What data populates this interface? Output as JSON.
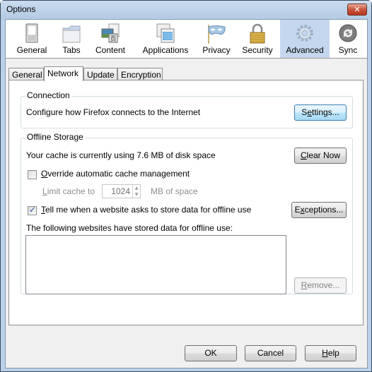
{
  "window": {
    "title": "Options",
    "close_label": "✕"
  },
  "toolbar": {
    "panes": [
      {
        "label": "General",
        "icon": "switch-icon",
        "selected": false
      },
      {
        "label": "Tabs",
        "icon": "folder-tab-icon",
        "selected": false
      },
      {
        "label": "Content",
        "icon": "content-icon",
        "selected": false
      },
      {
        "label": "Applications",
        "icon": "applications-icon",
        "selected": false
      },
      {
        "label": "Privacy",
        "icon": "mask-icon",
        "selected": false
      },
      {
        "label": "Security",
        "icon": "padlock-icon",
        "selected": false
      },
      {
        "label": "Advanced",
        "icon": "gear-icon",
        "selected": true
      },
      {
        "label": "Sync",
        "icon": "sync-icon",
        "selected": false
      }
    ]
  },
  "tabs": [
    {
      "label": "General",
      "active": false
    },
    {
      "label": "Network",
      "active": true
    },
    {
      "label": "Update",
      "active": false
    },
    {
      "label": "Encryption",
      "active": false
    }
  ],
  "connection": {
    "group_label": "Connection",
    "description": "Configure how Firefox connects to the Internet",
    "settings_button": {
      "pre": "S",
      "accel": "e",
      "post": "ttings..."
    }
  },
  "offline_storage": {
    "group_label": "Offline Storage",
    "cache_usage": "Your cache is currently using 7.6 MB of disk space",
    "clear_now_button": {
      "pre": "",
      "accel": "C",
      "post": "lear Now"
    },
    "override_checkbox": {
      "pre": "",
      "accel": "O",
      "post": "verride automatic cache management",
      "checked": false
    },
    "limit_label": {
      "pre": "",
      "accel": "L",
      "post": "imit cache to"
    },
    "limit_value": "1024",
    "limit_unit": "MB of space",
    "tell_me_checkbox": {
      "pre": "",
      "accel": "T",
      "post": "ell me when a website asks to store data for offline use",
      "checked": true
    },
    "exceptions_button": {
      "pre": "E",
      "accel": "x",
      "post": "ceptions..."
    },
    "stored_label": "The following websites have stored data for offline use:",
    "stored_sites": [],
    "remove_button": {
      "pre": "",
      "accel": "R",
      "post": "emove..."
    }
  },
  "footer": {
    "ok_label": "OK",
    "cancel_label": "Cancel",
    "help_button": {
      "pre": "",
      "accel": "H",
      "post": "elp"
    }
  }
}
